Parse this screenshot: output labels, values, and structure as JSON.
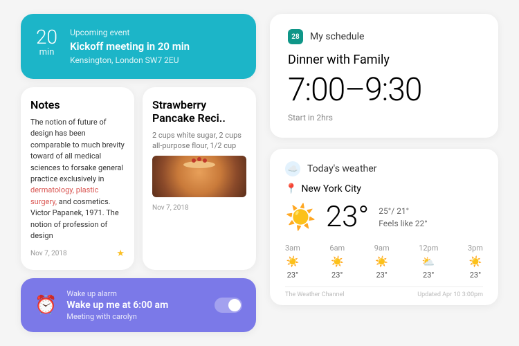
{
  "event": {
    "time_num": "20",
    "time_unit": "min",
    "label": "Upcoming event",
    "title": "Kickoff meeting in 20 min",
    "location": "Kensington, London SW7 2EU"
  },
  "notes": {
    "card1": {
      "title": "Notes",
      "body_html": "The notion of future of design has been comparable to much brevity toward of all medical sciences to forsake general practice exclusively in",
      "body_red": "dermatology, plastic surgery,",
      "body_tail": "and cosmetics. Victor Papanek, 1971. The notion of profession of design",
      "date": "Nov 7, 2018"
    },
    "card2": {
      "title": "Strawberry Pancake Reci..",
      "body": "2 cups white sugar, 2 cups all-purpose flour, 1/2 cup",
      "date": "Nov 7, 2018"
    }
  },
  "alarm": {
    "label": "Wake up alarm",
    "title": "Wake up me at 6:00 am",
    "sub": "Meeting with carolyn"
  },
  "schedule": {
    "icon_text": "28",
    "head": "My schedule",
    "title": "Dinner with Family",
    "time": "7:00–9:30",
    "start": "Start in 2hrs"
  },
  "weather": {
    "head": "Today's weather",
    "location": "New York City",
    "temp": "23",
    "unit": "°",
    "hilo": "25°/ 21°",
    "feels": "Feels like 22°",
    "hourly": [
      {
        "t": "3am",
        "ico": "☀️",
        "temp": "23°"
      },
      {
        "t": "6am",
        "ico": "☀️",
        "temp": "23°"
      },
      {
        "t": "9am",
        "ico": "☀️",
        "temp": "23°"
      },
      {
        "t": "12pm",
        "ico": "⛅",
        "temp": "23°"
      },
      {
        "t": "3pm",
        "ico": "☀️",
        "temp": "23°"
      }
    ],
    "source": "The Weather Channel",
    "updated": "Updated Apr 10  3:00pm"
  }
}
